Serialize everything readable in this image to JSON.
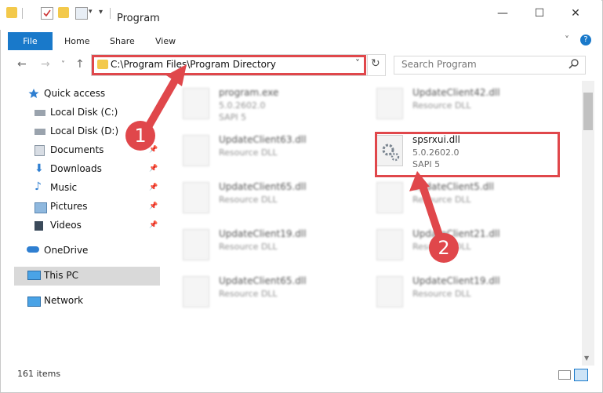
{
  "window": {
    "title": "Program",
    "minimize": "—",
    "maximize": "☐",
    "close": "✕",
    "help": "?",
    "collapse": "˅"
  },
  "ribbon": {
    "file": "File",
    "home": "Home",
    "share": "Share",
    "view": "View"
  },
  "nav": {
    "back": "←",
    "forward": "→",
    "recent": "˅",
    "up": "↑",
    "address": "C:\\Program Files\\Program Directory",
    "address_dropdown": "˅",
    "refresh": "↻",
    "search_placeholder": "Search Program"
  },
  "sidebar": {
    "quick_access": "Quick access",
    "items": [
      {
        "label": "Local Disk (C:)",
        "pinned": false,
        "icon": "drive-icon"
      },
      {
        "label": "Local Disk (D:)",
        "pinned": false,
        "icon": "drive-icon"
      },
      {
        "label": "Documents",
        "pinned": true,
        "icon": "documents-icon"
      },
      {
        "label": "Downloads",
        "pinned": true,
        "icon": "downloads-icon"
      },
      {
        "label": "Music",
        "pinned": true,
        "icon": "music-icon"
      },
      {
        "label": "Pictures",
        "pinned": true,
        "icon": "pictures-icon"
      },
      {
        "label": "Videos",
        "pinned": true,
        "icon": "videos-icon"
      }
    ],
    "onedrive": "OneDrive",
    "thispc": "This PC",
    "network": "Network"
  },
  "files": [
    {
      "name": "program.exe",
      "line2": "5.0.2602.0",
      "line3": "SAPI 5"
    },
    {
      "name": "UpdateClient42.dll",
      "line2": "Resource DLL",
      "line3": ""
    },
    {
      "name": "UpdateClient63.dll",
      "line2": "Resource DLL",
      "line3": ""
    },
    {
      "name": "spsrxui.dll",
      "line2": "5.0.2602.0",
      "line3": "SAPI 5"
    },
    {
      "name": "UpdateClient65.dll",
      "line2": "Resource DLL",
      "line3": ""
    },
    {
      "name": "UpdateClient5.dll",
      "line2": "Resource DLL",
      "line3": ""
    },
    {
      "name": "UpdateClient19.dll",
      "line2": "Resource DLL",
      "line3": ""
    },
    {
      "name": "UpdateClient21.dll",
      "line2": "Resource DLL",
      "line3": ""
    },
    {
      "name": "UpdateClient65.dll",
      "line2": "Resource DLL",
      "line3": ""
    },
    {
      "name": "UpdateClient19.dll",
      "line2": "Resource DLL",
      "line3": ""
    }
  ],
  "annotations": {
    "step1": "1",
    "step2": "2",
    "color": "#e0474b"
  },
  "status": {
    "count": "161 items"
  }
}
